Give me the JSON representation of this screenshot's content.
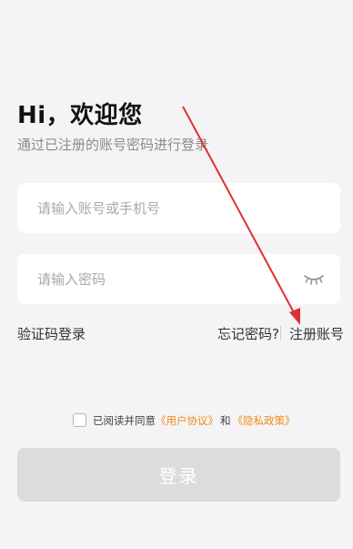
{
  "header": {
    "title": "Hi，欢迎您",
    "subtitle": "通过已注册的账号密码进行登录"
  },
  "form": {
    "account_placeholder": "请输入账号或手机号",
    "password_placeholder": "请输入密码"
  },
  "links": {
    "sms_login": "验证码登录",
    "forgot_password": "忘记密码?",
    "register": "注册账号"
  },
  "agreement": {
    "checked": false,
    "prefix": "已阅读并同意",
    "user_agreement": "《用户协议》",
    "and": "和",
    "privacy_policy": "《隐私政策》"
  },
  "login_button": {
    "label": "登录"
  },
  "colors": {
    "background": "#f4f4f6",
    "link_orange": "#f08a1c",
    "button_disabled": "#dcdcde",
    "annotation_arrow": "#e03030"
  },
  "icons": {
    "password_visibility": "closed-eye-icon"
  }
}
